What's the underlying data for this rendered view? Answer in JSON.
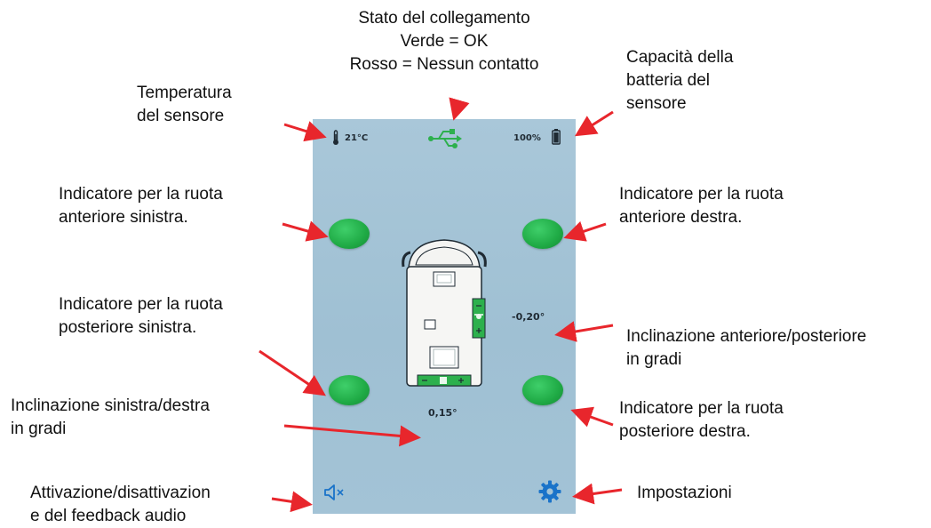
{
  "annotations": {
    "link_status": [
      "Stato del collegamento",
      "Verde = OK",
      "Rosso = Nessun contatto"
    ],
    "temperature": [
      "Temperatura",
      "del sensore"
    ],
    "battery": [
      "Capacità della",
      "batteria del",
      "sensore"
    ],
    "front_left": [
      "Indicatore per la ruota",
      "anteriore sinistra."
    ],
    "front_right": [
      "Indicatore per la ruota",
      "anteriore destra."
    ],
    "rear_left": [
      "Indicatore per la ruota",
      "posteriore sinistra."
    ],
    "pitch": [
      "Inclinazione anteriore/posteriore",
      "in gradi"
    ],
    "roll": [
      "Inclinazione sinistra/destra",
      "in gradi"
    ],
    "rear_right": [
      "Indicatore per la ruota",
      "posteriore destra."
    ],
    "audio": [
      "Attivazione/disattivazion",
      "e del feedback audio"
    ],
    "settings": [
      "Impostazioni"
    ]
  },
  "app": {
    "temperature": "21°C",
    "battery": "100%",
    "pitch_angle": "-0,20°",
    "roll_angle": "0,15°",
    "wheel_color": "#22b14c",
    "link_icon_color": "#2db04d",
    "accent_blue": "#1a73c9",
    "icons": {
      "temperature": "thermometer-icon",
      "link": "usb-link-icon",
      "battery": "battery-icon",
      "audio": "speaker-mute-icon",
      "settings": "gear-icon"
    }
  },
  "arrow_color": "#e8262c"
}
